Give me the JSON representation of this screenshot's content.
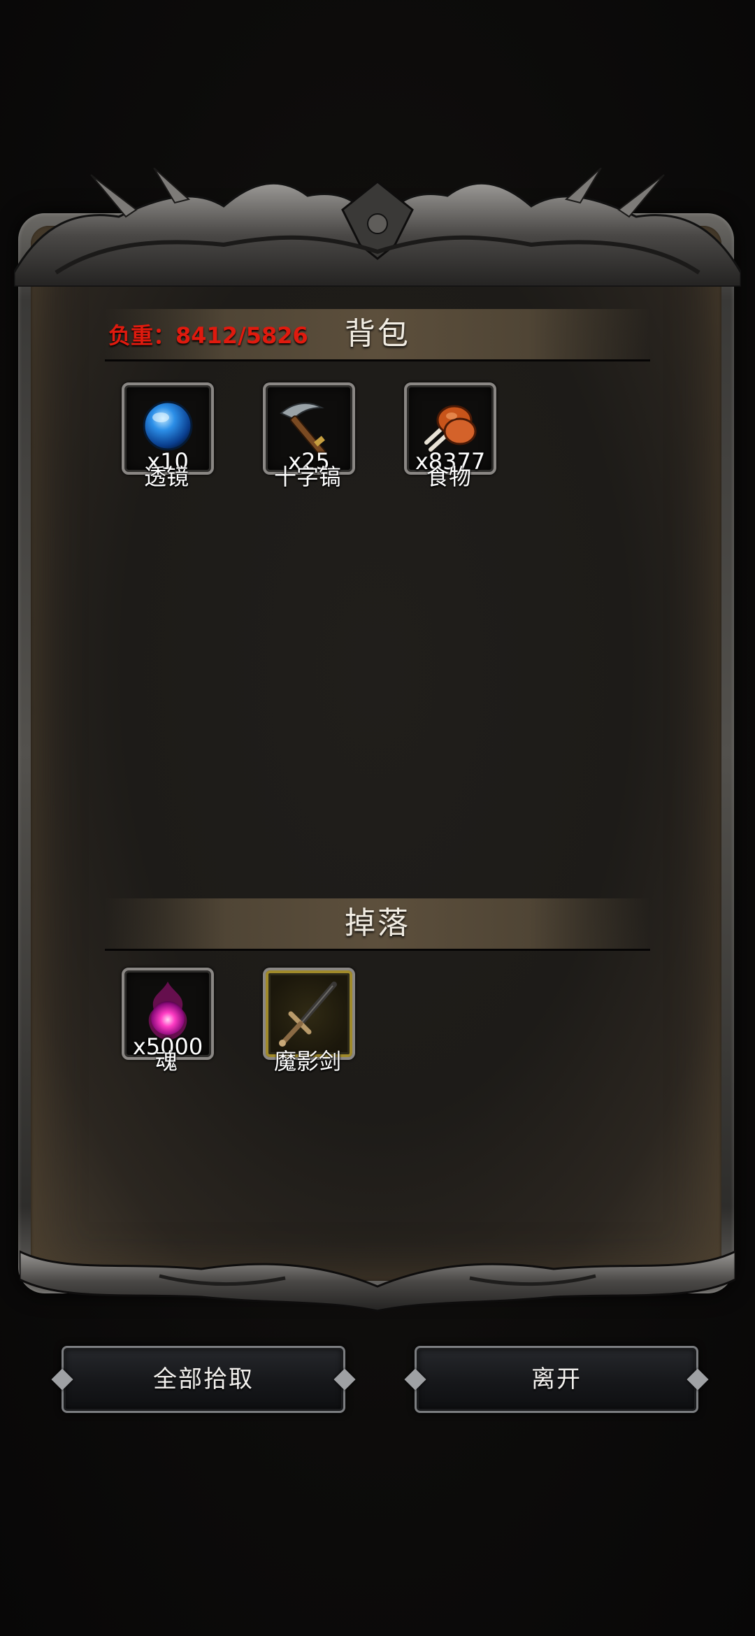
{
  "inventory": {
    "title": "背包",
    "weight_text": "负重：8412/5826",
    "items": [
      {
        "name": "透镜",
        "qty": "x10",
        "icon": "blue-orb-icon"
      },
      {
        "name": "十字镐",
        "qty": "x25",
        "icon": "pickaxe-icon"
      },
      {
        "name": "食物",
        "qty": "x8377",
        "icon": "meat-drumstick-icon"
      }
    ]
  },
  "drops": {
    "title": "掉落",
    "items": [
      {
        "name": "魂",
        "qty": "x5000",
        "icon": "pink-soul-icon"
      },
      {
        "name": "魔影剑",
        "qty": "",
        "icon": "sword-icon"
      }
    ]
  },
  "buttons": {
    "pickup_all": "全部拾取",
    "leave": "离开"
  },
  "colors": {
    "weight_text": "#e01a0e",
    "panel_bg": "#1e1c19",
    "frame_metal": "#5a5855",
    "rare_slot_border": "#a08a2a"
  }
}
